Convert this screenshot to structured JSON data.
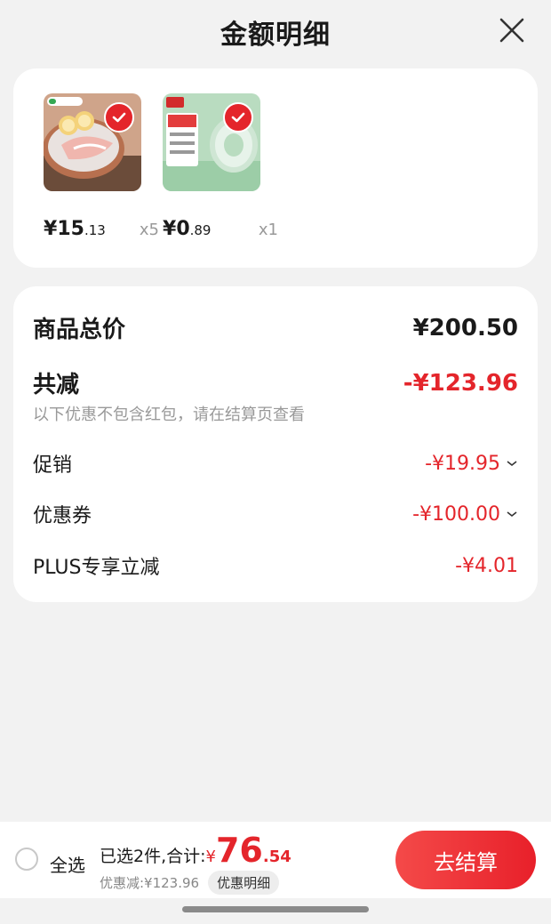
{
  "header": {
    "title": "金额明细"
  },
  "products": [
    {
      "name": "meat-product",
      "price_symbol": "¥",
      "price_int": "15",
      "price_dec": ".13",
      "qty": "x5",
      "badge_text": ""
    },
    {
      "name": "tape-product",
      "price_symbol": "¥",
      "price_int": "0",
      "price_dec": ".89",
      "qty": "x1",
      "badge_text": ""
    }
  ],
  "summary": {
    "total_label": "商品总价",
    "total_value": "¥200.50",
    "reduce_label": "共减",
    "reduce_value": "-¥123.96",
    "note": "以下优惠不包含红包，请在结算页查看",
    "promo_label": "促销",
    "promo_value": "-¥19.95",
    "coupon_label": "优惠券",
    "coupon_value": "-¥100.00",
    "plus_label": "PLUS专享立减",
    "plus_value": "-¥4.01"
  },
  "bottom": {
    "select_all": "全选",
    "selected_text": "已选2件,合计:",
    "currency": "¥",
    "total_int": "76",
    "total_dec": ".54",
    "discount_text": "优惠减:¥123.96",
    "detail_button": "优惠明细",
    "checkout_button": "去结算"
  },
  "colors": {
    "accent": "#e4252b",
    "background": "#f2f2f2"
  }
}
